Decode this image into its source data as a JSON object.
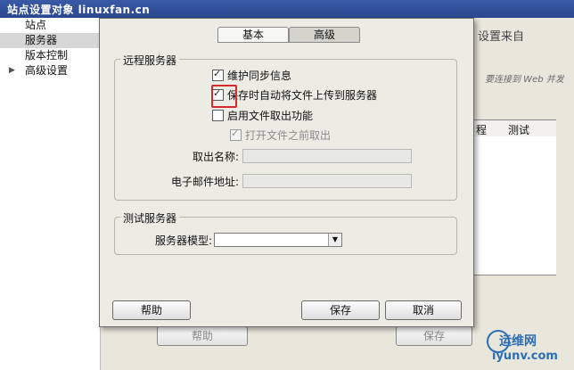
{
  "parent": {
    "title": "站点设置对象 linuxfan.cn",
    "sidebar": [
      "站点",
      "服务器",
      "版本控制",
      "高级设置"
    ],
    "sidebar_selected": 1,
    "right_text_1": "设置来自",
    "right_text_2": "要连接到 Web 并发",
    "table_headers": [
      "程",
      "测试"
    ],
    "help_label": "帮助",
    "save_label": "保存"
  },
  "dialog": {
    "tabs": [
      "基本",
      "高级"
    ],
    "active_tab": 1,
    "remote_group_label": "远程服务器",
    "checkboxes": [
      {
        "label": "维护同步信息",
        "checked": true,
        "disabled": false
      },
      {
        "label": "保存时自动将文件上传到服务器",
        "checked": true,
        "disabled": false
      },
      {
        "label": "启用文件取出功能",
        "checked": false,
        "disabled": false
      },
      {
        "label": "打开文件之前取出",
        "checked": true,
        "disabled": true
      }
    ],
    "checkout_name_label": "取出名称:",
    "checkout_name_value": "",
    "email_label": "电子邮件地址:",
    "email_value": "",
    "test_group_label": "测试服务器",
    "server_model_label": "服务器模型:",
    "server_model_value": "",
    "help_label": "帮助",
    "save_label": "保存",
    "cancel_label": "取消"
  },
  "watermark": {
    "line1": "运维网",
    "line2": "iyunv.com"
  }
}
